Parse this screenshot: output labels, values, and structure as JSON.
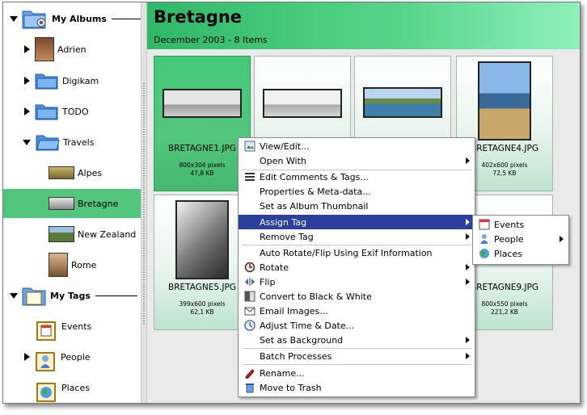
{
  "sidebar": {
    "albums_header": "My Albums",
    "albums": [
      {
        "label": "Adrien"
      },
      {
        "label": "Digikam"
      },
      {
        "label": "TODO"
      },
      {
        "label": "Travels"
      },
      {
        "label": "Alpes"
      },
      {
        "label": "Bretagne"
      },
      {
        "label": "New Zealand"
      },
      {
        "label": "Rome"
      }
    ],
    "tags_header": "My Tags",
    "tags": [
      {
        "label": "Events"
      },
      {
        "label": "People"
      },
      {
        "label": "Places"
      }
    ]
  },
  "main": {
    "title": "Bretagne",
    "subtitle": "December 2003 - 8 Items",
    "cards": [
      {
        "name": "BRETAGNE1.JPG",
        "dims": "800x304 pixels",
        "size": "47,8 KB"
      },
      {
        "name": "",
        "dims": "",
        "size": ""
      },
      {
        "name": "",
        "dims": "",
        "size": ""
      },
      {
        "name": "BRETAGNE4.JPG",
        "dims": "402x600 pixels",
        "size": "72,5 KB"
      },
      {
        "name": "BRETAGNE5.JPG",
        "dims": "399x600 pixels",
        "size": "62,1 KB"
      },
      {
        "name": "BRETAGNE9.JPG",
        "dims": "800x550 pixels",
        "size": "221,2 KB"
      }
    ]
  },
  "context_menu": {
    "items": [
      {
        "label": "View/Edit...",
        "icon": "view-edit-icon"
      },
      {
        "label": "Open With",
        "icon": ""
      },
      {
        "label": "Edit Comments & Tags...",
        "icon": "comments-icon"
      },
      {
        "label": "Properties & Meta-data...",
        "icon": ""
      },
      {
        "label": "Set as Album Thumbnail",
        "icon": ""
      },
      {
        "label": "Assign Tag",
        "icon": ""
      },
      {
        "label": "Remove Tag",
        "icon": ""
      },
      {
        "label": "Auto Rotate/Flip Using Exif Information",
        "icon": ""
      },
      {
        "label": "Rotate",
        "icon": "rotate-icon"
      },
      {
        "label": "Flip",
        "icon": "flip-icon"
      },
      {
        "label": "Convert to Black & White",
        "icon": "black-white-icon"
      },
      {
        "label": "Email Images...",
        "icon": "email-icon"
      },
      {
        "label": "Adjust Time & Date...",
        "icon": "clock-icon"
      },
      {
        "label": "Set as Background",
        "icon": ""
      },
      {
        "label": "Batch Processes",
        "icon": ""
      },
      {
        "label": "Rename...",
        "icon": "rename-icon"
      },
      {
        "label": "Move to Trash",
        "icon": "trash-icon"
      }
    ],
    "tag_submenu": [
      {
        "label": "Events"
      },
      {
        "label": "People"
      },
      {
        "label": "Places"
      }
    ]
  },
  "colors": {
    "accent_green": "#52c67e",
    "menu_highlight": "#2b3f9c"
  }
}
